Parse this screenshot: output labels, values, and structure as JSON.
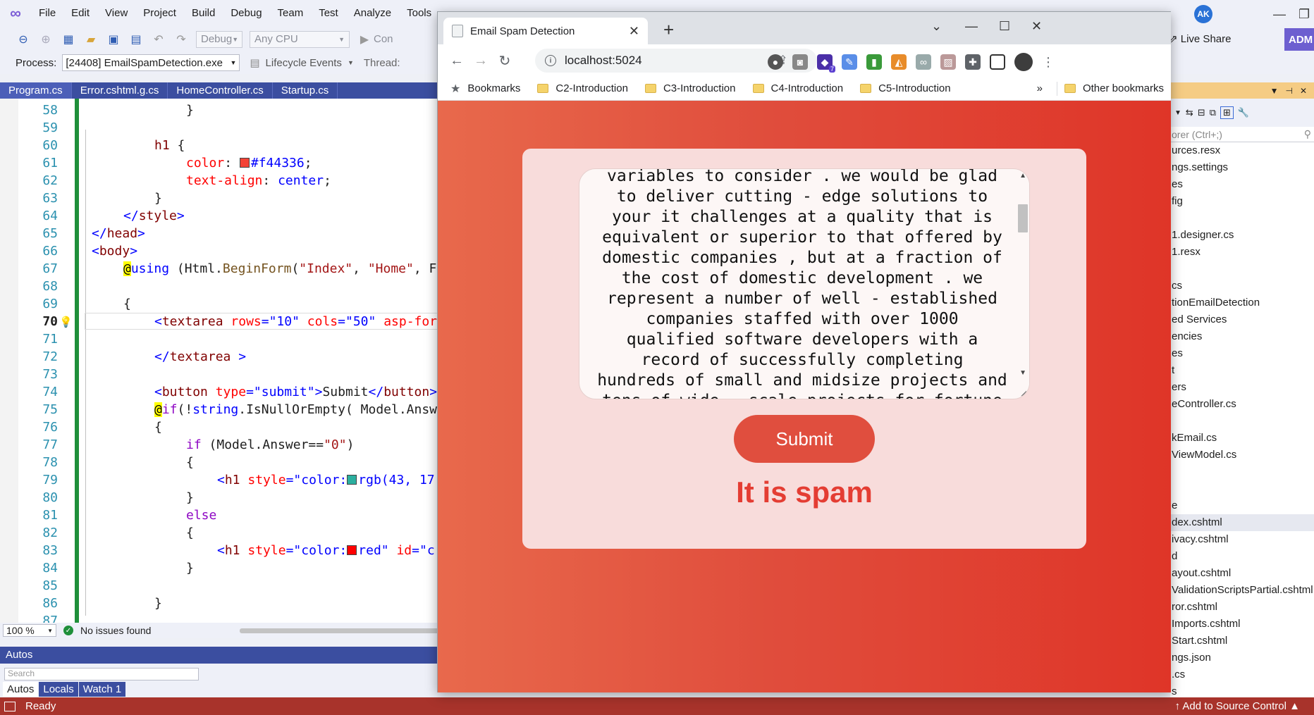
{
  "vs": {
    "menu": [
      "File",
      "Edit",
      "View",
      "Project",
      "Build",
      "Debug",
      "Team",
      "Test",
      "Analyze",
      "Tools"
    ],
    "toolbar": {
      "config": "Debug",
      "platform": "Any CPU",
      "continue_label": "Con"
    },
    "process": {
      "label": "Process:",
      "value": "[24408] EmailSpamDetection.exe",
      "lifecycle": "Lifecycle Events",
      "thread": "Thread:"
    },
    "user_initials": "AK",
    "live_share": "Live Share",
    "adm": "ADM",
    "doc_tabs": [
      "Program.cs",
      "Error.cshtml.g.cs",
      "HomeController.cs",
      "Startup.cs"
    ],
    "editor": {
      "line_numbers": [
        "58",
        "59",
        "60",
        "61",
        "62",
        "63",
        "64",
        "65",
        "66",
        "67",
        "68",
        "69",
        "70",
        "71",
        "72",
        "73",
        "74",
        "75",
        "76",
        "77",
        "78",
        "79",
        "80",
        "81",
        "82",
        "83",
        "84",
        "85",
        "86",
        "87"
      ]
    },
    "editor_status": {
      "zoom": "100 %",
      "issues": "No issues found"
    },
    "autos": {
      "title": "Autos",
      "search_placeholder": "Search",
      "tabs": [
        "Autos",
        "Locals",
        "Watch 1"
      ]
    },
    "status": {
      "ready": "Ready",
      "source_control": "Add to Source Control"
    },
    "solution": {
      "search_placeholder": "orer (Ctrl+;)",
      "items": [
        "urces.resx",
        "ngs.settings",
        "es",
        "fig",
        "",
        "1.designer.cs",
        "1.resx",
        "",
        "cs",
        "tionEmailDetection",
        "ed Services",
        "encies",
        "es",
        "t",
        "ers",
        "eController.cs",
        "",
        "kEmail.cs",
        "ViewModel.cs",
        "",
        "",
        "e",
        "dex.cshtml",
        "ivacy.cshtml",
        "d",
        "ayout.cshtml",
        "ValidationScriptsPartial.cshtml",
        "ror.cshtml",
        "Imports.cshtml",
        "Start.cshtml",
        "ngs.json",
        ".cs",
        "s"
      ]
    }
  },
  "browser": {
    "tab_title": "Email Spam Detection",
    "url": "localhost:5024",
    "bookmarks": [
      "Bookmarks",
      "C2-Introduction",
      "C3-Introduction",
      "C4-Introduction",
      "C5-Introduction"
    ],
    "other_bookmarks": "Other bookmarks",
    "more_bookmarks": "»",
    "extension_badge": "7"
  },
  "page": {
    "textarea_text": "variables to consider .  we would be glad\nto deliver cutting - edge solutions to\nyour it challenges  at a quality that is\nequivalent or superior to that offered by\ndomestic  companies , but at a fraction of\nthe cost of domestic development .  we\nrepresent a number of well - established\ncompanies staffed with over  1000\nqualified software developers with a\nrecord of successfully completing\nhundreds of small and midsize projects and\ntens of wide - scale projects for fortune",
    "submit_label": "Submit",
    "result": "It is spam",
    "colors": {
      "gradient_start": "#e8694c",
      "gradient_end": "#df3528",
      "result_color": "#e43d33",
      "button": "#e04e3e"
    }
  }
}
